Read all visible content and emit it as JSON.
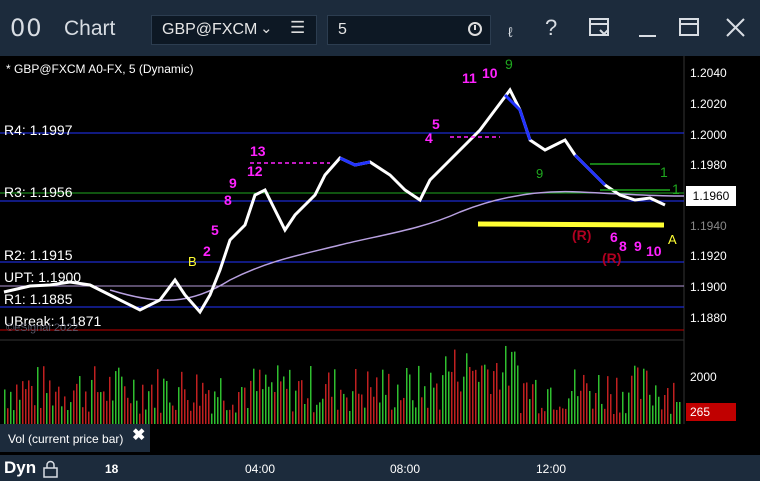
{
  "window": {
    "app_icon": "00",
    "title": "Chart",
    "symbol": "GBP@FXCM",
    "interval": "5",
    "icons": [
      "chevron-down-icon",
      "menu-icon",
      "clock-icon",
      "draw-icon",
      "help-icon",
      "layout-icon",
      "minimize-icon",
      "maximize-icon",
      "close-icon"
    ]
  },
  "chart": {
    "indicator_label": "* GBP@FXCM A0-FX, 5 (Dynamic)",
    "price_ticks": [
      "1.2040",
      "1.2020",
      "1.2000",
      "1.1980",
      "1.1960",
      "1.1940",
      "1.1920",
      "1.1900",
      "1.1880"
    ],
    "current_price": "1.1960",
    "levels": {
      "r4": "R4: 1.1997",
      "r3": "R3: 1.1956",
      "r2": "R2: 1.1915",
      "upt": "UPT: 1.1900",
      "r1": "R1: 1.1885",
      "ubreak": "UBreak: 1.1871"
    },
    "copyright": "©eSignal 2022",
    "markers": {
      "b": "B",
      "a": "A",
      "r1": "(R)",
      "r2": "(R)",
      "one_a": "1",
      "one_b": "1",
      "nine": "9",
      "nine2": "9",
      "m13": "13",
      "m12": "12",
      "m9": "9",
      "m8": "8",
      "m5": "5",
      "m2": "2",
      "m11": "11",
      "m10a": "10",
      "m4": "4",
      "m5b": "5",
      "m6": "6",
      "m8b": "8",
      "m9b": "9",
      "m10b": "10"
    }
  },
  "volume": {
    "tab_label": "Vol (current price bar)",
    "tick": "2000",
    "current": "265"
  },
  "bottom": {
    "dyn": "Dyn",
    "times": [
      "18",
      "04:00",
      "08:00",
      "12:00"
    ]
  },
  "colors": {
    "titlebar": "#1c2b3c",
    "magenta": "#ff22ff",
    "green": "#1fa81f",
    "yellow": "#ffff33",
    "blue": "#2233ff",
    "purple_ma": "#b8a0e0"
  }
}
